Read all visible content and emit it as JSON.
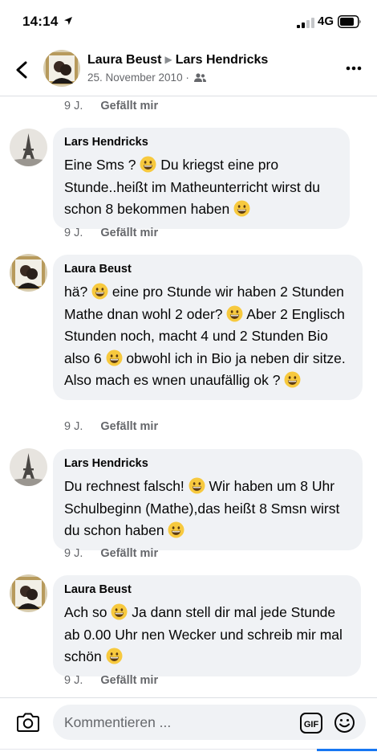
{
  "status_bar": {
    "time": "14:14",
    "network": "4G"
  },
  "header": {
    "author": "Laura Beust",
    "recipient": "Lars Hendricks",
    "date": "25. November 2010 ·",
    "back_icon": "chevron-left-icon",
    "more_icon": "more-horizontal-icon"
  },
  "top_meta": {
    "time": "9 J.",
    "like": "Gefällt mir"
  },
  "comments": [
    {
      "author": "Lars Hendricks",
      "parts": [
        "Eine Sms ? ",
        " Du kriegst eine pro Stunde..heißt im Matheunterricht wirst du schon 8 bekommen haben "
      ],
      "time": "9 J.",
      "like": "Gefällt mir"
    },
    {
      "author": "Laura Beust",
      "parts": [
        "hä? ",
        " eine pro Stunde wir haben 2 Stunden Mathe dnan wohl 2 oder? ",
        "  Aber 2 Englisch Stunden noch, macht 4 und 2 Stunden Bio also 6 ",
        " obwohl ich in Bio ja neben dir sitze. Also mach es wnen unaufällig ok ? "
      ],
      "time": "9 J.",
      "like": "Gefällt mir"
    },
    {
      "author": "Lars Hendricks",
      "parts": [
        "Du rechnest falsch! ",
        " Wir haben um 8 Uhr Schulbeginn (Mathe),das heißt 8 Smsn wirst du schon haben "
      ],
      "time": "9 J.",
      "like": "Gefällt mir"
    },
    {
      "author": "Laura Beust",
      "parts": [
        "Ach so ",
        " Ja dann stell dir mal jede Stunde ab 0.00 Uhr nen Wecker und schreib mir mal schön "
      ],
      "time": "9 J.",
      "like": "Gefällt mir"
    }
  ],
  "comment_bar": {
    "placeholder": "Kommentieren ...",
    "gif_label": "GIF"
  },
  "colors": {
    "bubble": "#f0f2f5",
    "secondary_text": "#65676b",
    "emoji": "#f7c93e",
    "accent": "#1877f2"
  }
}
